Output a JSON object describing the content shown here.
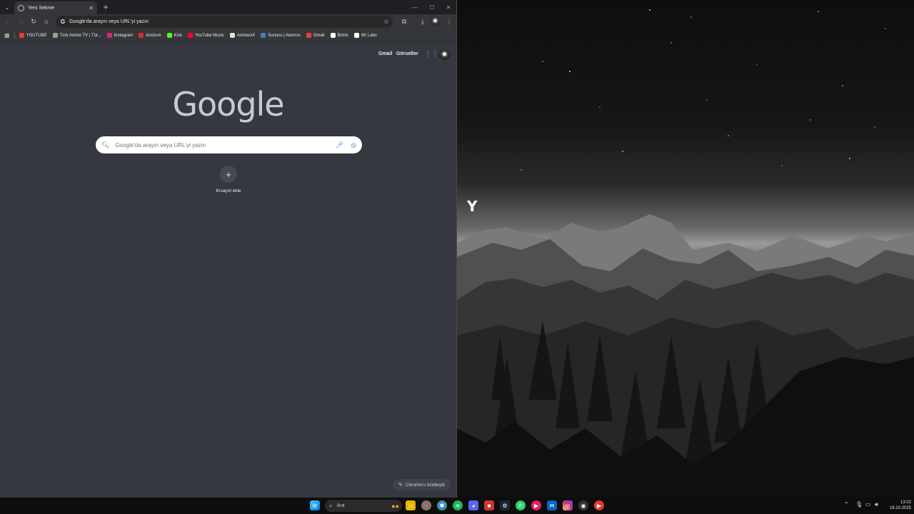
{
  "browser": {
    "tab": {
      "title": "Yeni Sekme",
      "favicon": "chrome-globe-icon"
    },
    "new_tab_label": "+",
    "omnibox": {
      "text": "Google'da arayın veya URL'yi yazın"
    },
    "bookmarks": [
      {
        "label": "YOUTUBE",
        "color": "#e53935"
      },
      {
        "label": "Türk Anime TV | Tür...",
        "color": "#9e9e9e"
      },
      {
        "label": "Instagram",
        "color": "#d62976"
      },
      {
        "label": "Anizium",
        "color": "#d32f2f"
      },
      {
        "label": "Kick",
        "color": "#53fc18"
      },
      {
        "label": "YouTube Music",
        "color": "#ff0033"
      },
      {
        "label": "AnimeciX",
        "color": "#e0e0e0"
      },
      {
        "label": "Sunucu | Aternos",
        "color": "#3f7fbf"
      },
      {
        "label": "Gmail",
        "color": "#ea4335"
      },
      {
        "label": "Botrix",
        "color": "#ffffff"
      },
      {
        "label": "6K Labs",
        "color": "#ffffff"
      }
    ]
  },
  "ntp": {
    "gmail": "Gmail",
    "images": "Görseller",
    "logo": "Google",
    "search_placeholder": "Google'da arayın veya URL'yi yazın",
    "shortcut_label": "Kısayol ekle",
    "customize_label": "Chrome'u özelleştir"
  },
  "desktop": {
    "taskbar": {
      "search_label": "Ara",
      "clock_time": "13:02",
      "clock_date": "19.10.2025"
    }
  }
}
